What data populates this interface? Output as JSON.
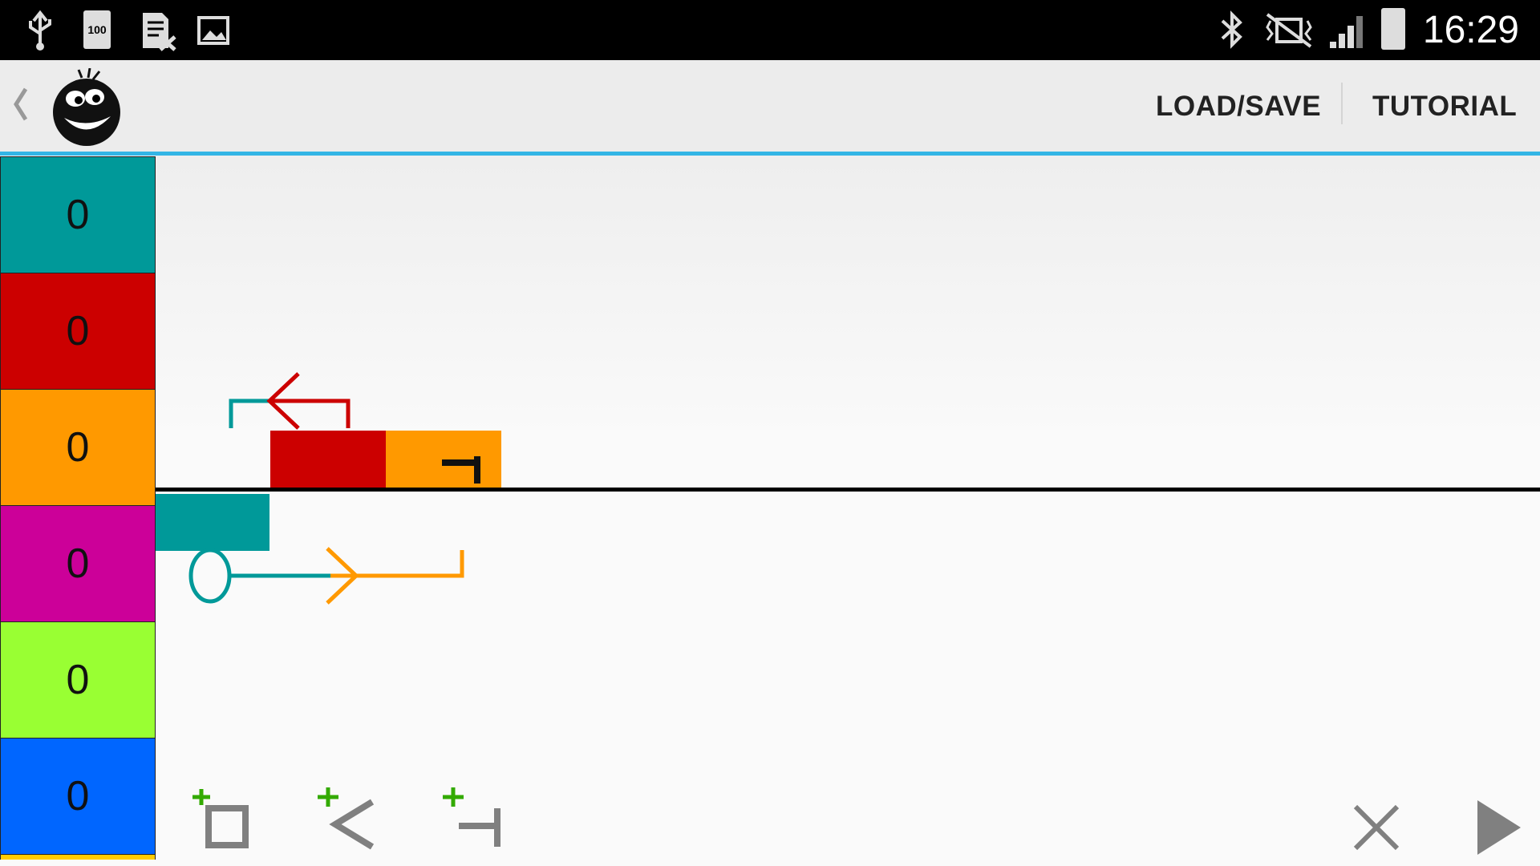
{
  "status_bar": {
    "time": "16:29",
    "battery_label": "100",
    "icons": [
      "usb-icon",
      "battery-full-icon",
      "sd-card-error-icon",
      "image-icon",
      "bluetooth-icon",
      "vibrate-off-icon",
      "signal-icon",
      "battery-icon"
    ]
  },
  "action_bar": {
    "back_icon": "chevron-left-icon",
    "logo_icon": "smiley-ball-icon",
    "load_save_label": "LOAD/SAVE",
    "tutorial_label": "TUTORIAL"
  },
  "palette": [
    {
      "color": "#009999",
      "count": "0"
    },
    {
      "color": "#cc0000",
      "count": "0"
    },
    {
      "color": "#ff9900",
      "count": "0"
    },
    {
      "color": "#cc0099",
      "count": "0"
    },
    {
      "color": "#99ff33",
      "count": "0"
    },
    {
      "color": "#0066ff",
      "count": "0"
    }
  ],
  "toolbar": {
    "add_block_icon": "add-block-icon",
    "add_arrow_icon": "add-arrow-icon",
    "add_stop_icon": "add-stop-icon",
    "delete_icon": "close-icon",
    "play_icon": "play-icon"
  },
  "colors": {
    "accent": "#33b5e5",
    "teal": "#009999",
    "red": "#cc0000",
    "orange": "#ff9900",
    "magenta": "#cc0099",
    "lime": "#99ff33",
    "blue": "#0066ff",
    "tool_plus": "#33aa00",
    "tool_grey": "#808080"
  }
}
